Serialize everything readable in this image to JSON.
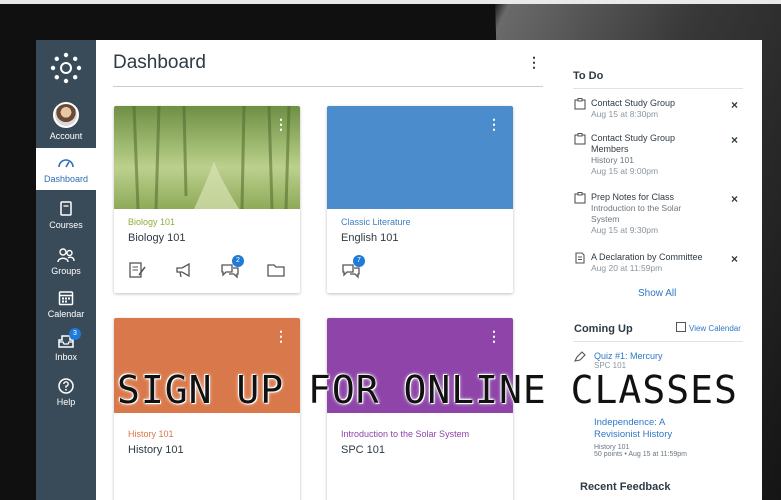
{
  "nav": {
    "account": "Account",
    "dashboard": "Dashboard",
    "courses": "Courses",
    "groups": "Groups",
    "calendar": "Calendar",
    "inbox": "Inbox",
    "inbox_badge": "3",
    "help": "Help"
  },
  "page": {
    "title": "Dashboard"
  },
  "cards": [
    {
      "code": "Biology 101",
      "name": "Biology 101",
      "color": "#8fae5a",
      "code_color": "#8fae3a",
      "badge": "2"
    },
    {
      "code": "Classic Literature",
      "name": "English 101",
      "color": "#4a8ccc",
      "code_color": "#3d7fc0",
      "badge": "7"
    },
    {
      "code": "History 101",
      "name": "History 101",
      "color": "#d9784a",
      "code_color": "#d9784a"
    },
    {
      "code": "Introduction to the Solar System",
      "name": "SPC 101",
      "color": "#8e44a8",
      "code_color": "#8e44a8"
    }
  ],
  "todo": {
    "title": "To Do",
    "items": [
      {
        "title": "Contact Study Group",
        "sub": "",
        "date": "Aug 15 at 8:30pm"
      },
      {
        "title": "Contact Study Group Members",
        "sub": "History 101",
        "date": "Aug 15 at 9:00pm"
      },
      {
        "title": "Prep Notes for Class",
        "sub": "Introduction to the Solar System",
        "date": "Aug 15 at 9:30pm"
      },
      {
        "title": "A Declaration by Committee",
        "sub": "",
        "date": "Aug 20 at 11:59pm"
      }
    ],
    "show_all": "Show All",
    "close": "×"
  },
  "coming_up": {
    "title": "Coming Up",
    "view_calendar": "View Calendar",
    "items": [
      {
        "title": "Quiz #1: Mercury",
        "sub": "SPC 101"
      },
      {
        "title": "Independence: A Revisionist History",
        "sub": "History 101",
        "date": "50 points • Aug 15 at 11:59pm"
      }
    ]
  },
  "recent_feedback": {
    "title": "Recent Feedback"
  },
  "overlay": {
    "text": "SIGN UP FOR ONLINE CLASSES"
  },
  "colors": {
    "nav_bg": "#394b58",
    "link": "#2d77c7",
    "bezel": "#101010"
  }
}
